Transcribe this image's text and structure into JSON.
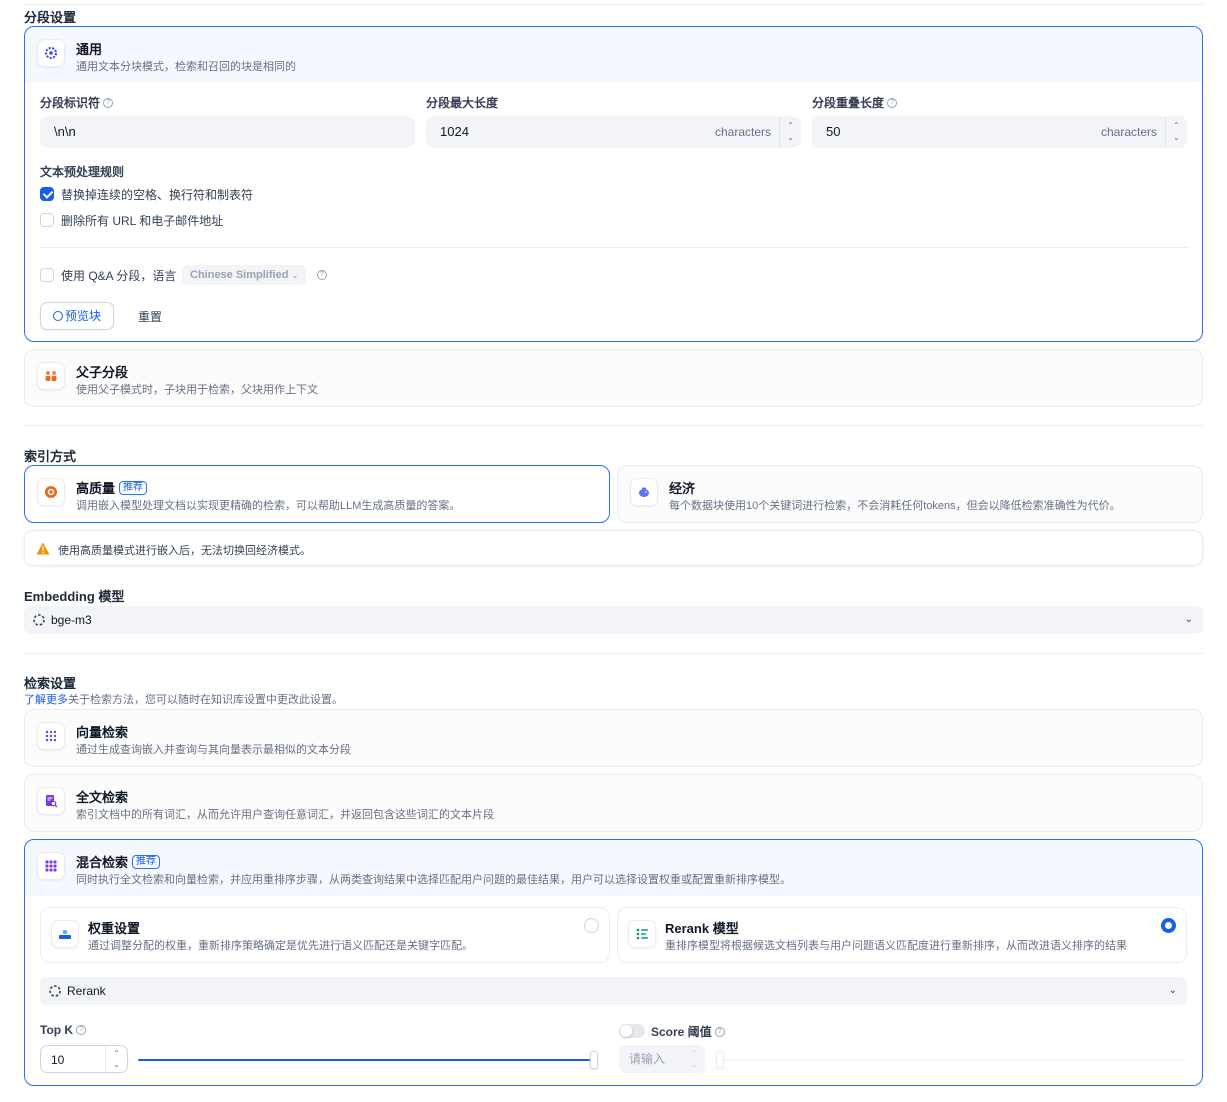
{
  "segment": {
    "section_title": "分段设置",
    "general": {
      "title": "通用",
      "desc": "通用文本分块模式，检索和召回的块是相同的",
      "delimiter_label": "分段标识符",
      "delimiter_value": "\\n\\n",
      "max_length_label": "分段最大长度",
      "max_length_value": "1024",
      "overlap_label": "分段重叠长度",
      "overlap_value": "50",
      "unit": "characters",
      "rules_title": "文本预处理规则",
      "rule_replace": "替换掉连续的空格、换行符和制表符",
      "rule_remove_urls": "删除所有 URL 和电子邮件地址",
      "qa_label": "使用 Q&A 分段，语言",
      "qa_language": "Chinese Simplified",
      "preview_button": "预览块",
      "reset_button": "重置"
    },
    "parent_child": {
      "title": "父子分段",
      "desc": "使用父子模式时，子块用于检索，父块用作上下文"
    }
  },
  "index": {
    "section_title": "索引方式",
    "high_quality": {
      "title": "高质量",
      "badge": "推荐",
      "desc": "调用嵌入模型处理文档以实现更精确的检索，可以帮助LLM生成高质量的答案。"
    },
    "economy": {
      "title": "经济",
      "desc": "每个数据块使用10个关键词进行检索，不会消耗任何tokens，但会以降低检索准确性为代价。"
    },
    "warning": "使用高质量模式进行嵌入后，无法切换回经济模式。"
  },
  "embedding": {
    "label": "Embedding 模型",
    "model": "bge-m3"
  },
  "retrieval": {
    "section_title": "检索设置",
    "learn_more": "了解更多",
    "subtitle": "关于检索方法，您可以随时在知识库设置中更改此设置。",
    "vector": {
      "title": "向量检索",
      "desc": "通过生成查询嵌入并查询与其向量表示最相似的文本分段"
    },
    "fulltext": {
      "title": "全文检索",
      "desc": "索引文档中的所有词汇，从而允许用户查询任意词汇，并返回包含这些词汇的文本片段"
    },
    "hybrid": {
      "title": "混合检索",
      "badge": "推荐",
      "desc": "同时执行全文检索和向量检索，并应用重排序步骤，从两类查询结果中选择匹配用户问题的最佳结果，用户可以选择设置权重或配置重新排序模型。",
      "weight": {
        "title": "权重设置",
        "desc": "通过调整分配的权重，重新排序策略确定是优先进行语义匹配还是关键字匹配。"
      },
      "rerank": {
        "title": "Rerank 模型",
        "desc": "重排序模型将根据候选文档列表与用户问题语义匹配度进行重新排序，从而改进语义排序的结果"
      },
      "rerank_model": "Rerank",
      "topk_label": "Top K",
      "topk_value": "10",
      "topk_fraction": 1.0,
      "score_label": "Score 阈值",
      "score_placeholder": "请输入"
    }
  },
  "colors": {
    "accent": "#155eef",
    "warning": "#f79009"
  }
}
